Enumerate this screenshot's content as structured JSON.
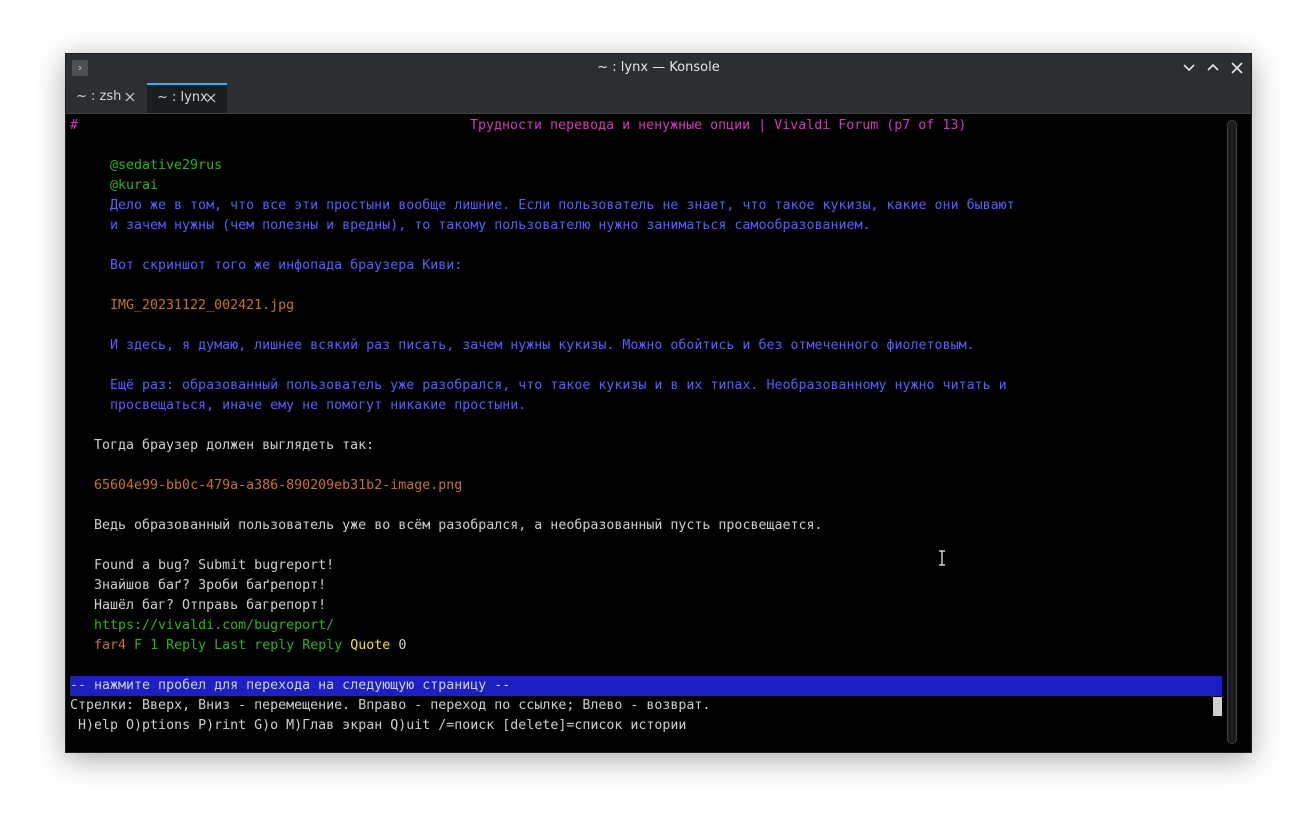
{
  "window": {
    "title": "~ : lynx — Konsole"
  },
  "tabs": [
    {
      "label": "~ : zsh",
      "active": false
    },
    {
      "label": "~ : lynx",
      "active": true
    }
  ],
  "terminal": {
    "hash": "#",
    "page_title": "Трудности перевода и ненужные опции | Vivaldi Forum (p7 of 13)",
    "quote_user1": "@sedative29rus",
    "quote_user2": "@kurai",
    "quote_text1": "Дело же в том, что все эти простыни вообще лишние. Если пользователь не знает, что такое кукизы, какие они бывают",
    "quote_text2": "и зачем нужны (чем полезны и вредны), то такому пользователю нужно заниматься самообразованием.",
    "quote_text3": "Вот скриншот того же инфопада браузера Киви:",
    "quote_image": "IMG_20231122_002421.jpg",
    "quote_text4": "И здесь, я думаю, лишнее всякий раз писать, зачем нужны кукизы. Можно обойтись и без отмеченного фиолетовым.",
    "quote_text5": "Ещё раз: образованный пользователь уже разобрался, что такое кукизы и в их типах. Необразованному нужно читать и",
    "quote_text6": "просвещаться, иначе ему не помогут никакие простыни.",
    "body_text1": "Тогда браузер должен выглядеть так:",
    "body_image": "65604e99-bb0c-479a-a386-890209eb31b2-image.png",
    "body_text2": "Ведь образованный пользователь уже во всём разобрался, а необразованный пусть просвещается.",
    "sig_line1": "Found a bug? Submit bugreport!",
    "sig_line2": "Знайшов баґ? Зроби баґрепорт!",
    "sig_line3": "Нашёл баг? Отправь багрепорт!",
    "sig_link": "https://vivaldi.com/bugreport/",
    "footer_user": "far4",
    "footer_f": "F",
    "footer_count": "1",
    "footer_reply": "Reply",
    "footer_last_reply": "Last reply",
    "footer_reply2": "Reply",
    "footer_quote": "Quote",
    "footer_zero": "0",
    "status_prompt": "-- нажмите пробел для перехода на следующую страницу --",
    "help_line1": "Стрелки: Вверх, Вниз - перемещение. Вправо - переход по ссылке; Влево - возврат.",
    "help_line2": " H)elp O)ptions P)rint G)o M)Глав экран Q)uit /=поиск [delete]=список истории"
  },
  "colors": {
    "link_green": "#33b31a",
    "quote_violet": "#5c5cff",
    "image_orange": "#c8732a",
    "title_magenta": "#d13ab8",
    "quote_yellow": "#f3de38",
    "status_bar_blue": "#1d1fc2",
    "tab_accent": "#3daee9"
  }
}
